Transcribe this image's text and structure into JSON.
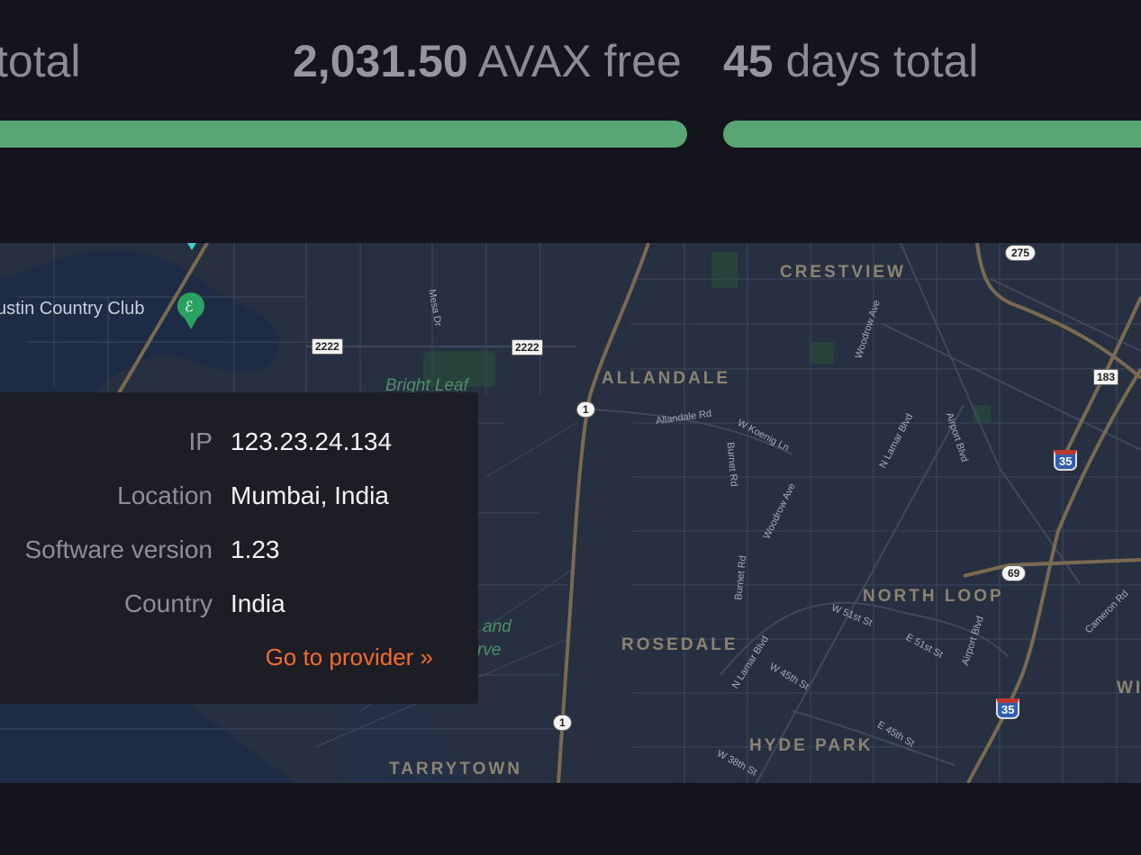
{
  "stats": {
    "left": {
      "unit": "total"
    },
    "middle": {
      "value": "2,031.50",
      "unit": "AVAX free"
    },
    "right": {
      "value": "45",
      "unit": "days total"
    }
  },
  "progress": {
    "left_fill": 1.0,
    "right_fill": 1.0,
    "color": "#5aa574"
  },
  "map": {
    "districts": [
      "CRESTVIEW",
      "ALLANDALE",
      "NORTH LOOP",
      "ROSEDALE",
      "HYDE PARK",
      "TARRYTOWN",
      "WI"
    ],
    "places": [
      "ustin Country Club"
    ],
    "parks": [
      "Bright Leaf",
      "and",
      "rve"
    ],
    "streets": [
      "Mesa Dr",
      "Woodrow Ave",
      "Allandale Rd",
      "W Koenig Ln",
      "Burnet Rd",
      "N Lamar Blvd",
      "Airport Blvd",
      "Woodrow Ave",
      "Burnet Rd",
      "W 51st St",
      "E 51st St",
      "Airport Blvd",
      "N Lamar Blvd",
      "W 45th St",
      "E 45th St",
      "W 38th St",
      "Cameron Rd"
    ],
    "shields": [
      "2222",
      "2222",
      "1",
      "1",
      "275",
      "183",
      "35",
      "69",
      "35"
    ]
  },
  "popup": {
    "rows": [
      {
        "label": "IP",
        "value": "123.23.24.134"
      },
      {
        "label": "Location",
        "value": "Mumbai, India"
      },
      {
        "label": "Software version",
        "value": "1.23"
      },
      {
        "label": "Country",
        "value": "India"
      }
    ],
    "link_label": "Go to provider »"
  },
  "colors": {
    "background": "#14151c",
    "map": "#263041",
    "accent": "#f26b2a",
    "bar": "#5aa574"
  }
}
